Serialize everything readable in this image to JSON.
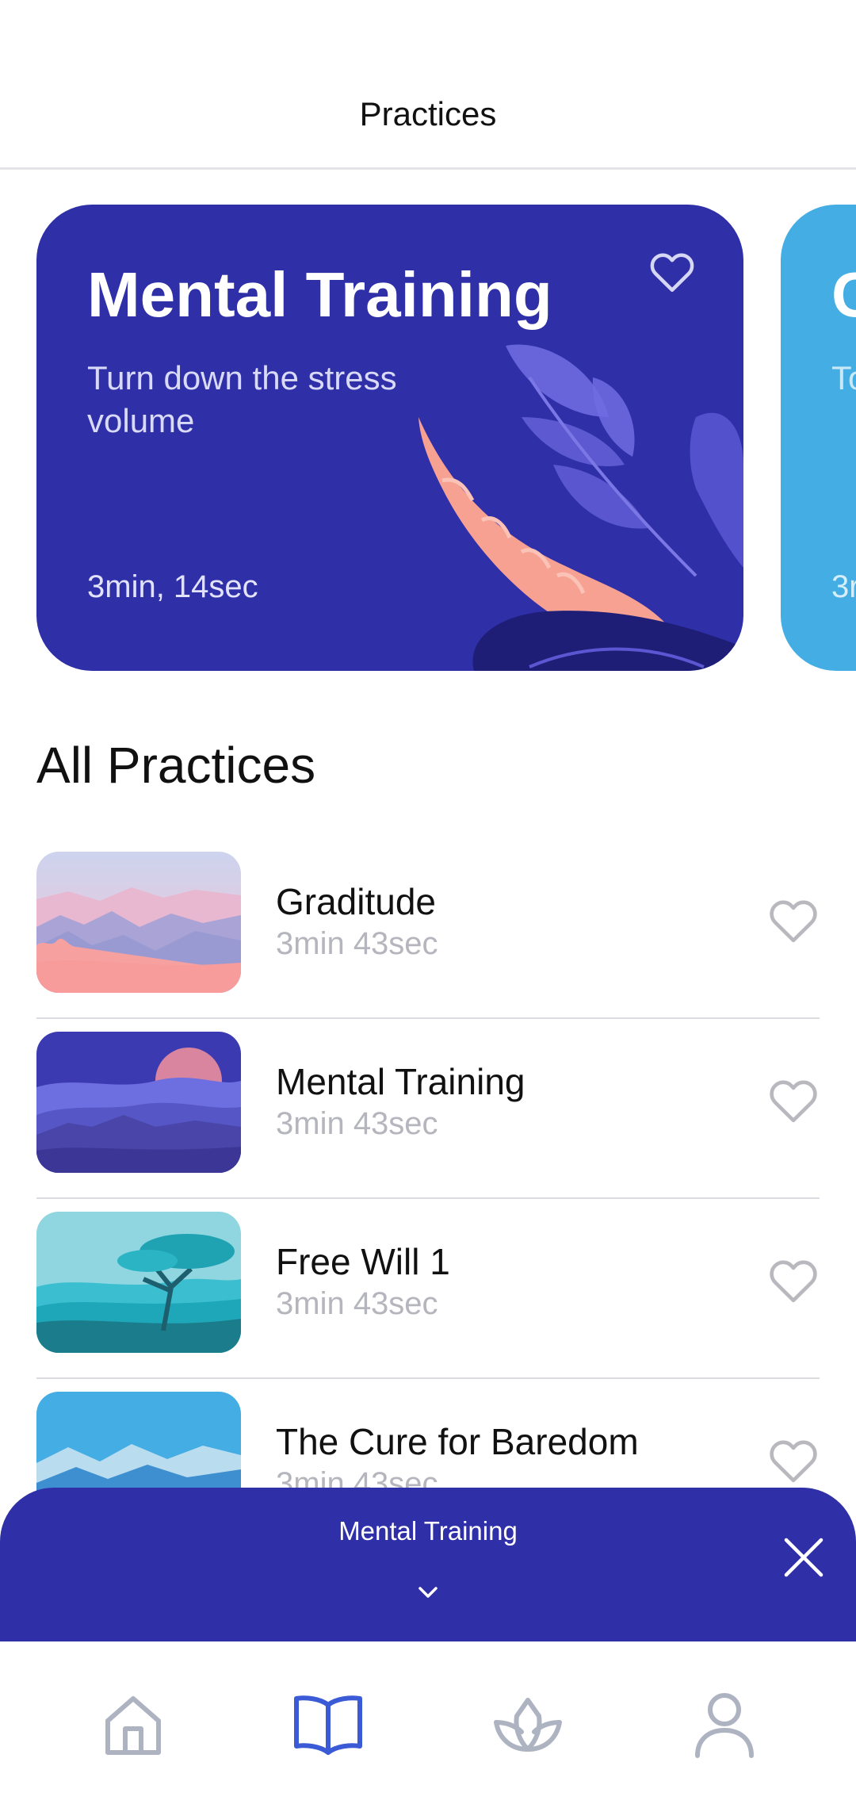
{
  "header": {
    "title": "Practices"
  },
  "featured": [
    {
      "title": "Mental Training",
      "subtitle": "Turn down the stress volume",
      "duration": "3min, 14sec",
      "favorite_icon": "heart-outline-icon",
      "background": "#2f2fa8"
    },
    {
      "title": "C",
      "subtitle": "To",
      "duration": "3r",
      "background": "#44ade3"
    }
  ],
  "all_practices": {
    "title": "All Practices",
    "items": [
      {
        "title": "Graditude",
        "duration": "3min 43sec",
        "icon": "heart-outline-icon"
      },
      {
        "title": "Mental Training",
        "duration": "3min 43sec",
        "icon": "heart-outline-icon"
      },
      {
        "title": "Free Will 1",
        "duration": "3min 43sec",
        "icon": "heart-outline-icon"
      },
      {
        "title": "The Cure for Baredom",
        "duration": "3min 43sec",
        "icon": "heart-outline-icon"
      }
    ]
  },
  "player": {
    "title": "Mental Training",
    "expand_icon": "chevron-down-icon",
    "close_icon": "close-icon"
  },
  "tabbar": {
    "active_tab": "library",
    "tabs": [
      {
        "icon": "home-icon"
      },
      {
        "icon": "book-icon"
      },
      {
        "icon": "lotus-icon"
      },
      {
        "icon": "profile-icon"
      }
    ]
  },
  "colors": {
    "accent": "#2f2fa8",
    "secondary_card": "#44ade3",
    "tab_active": "#3b5bd6",
    "tab_inactive": "#aeb3c2",
    "heart_outline": "#b8b8be"
  }
}
